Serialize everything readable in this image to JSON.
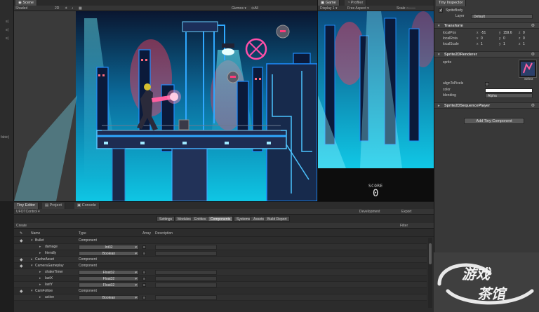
{
  "scene_panel": {
    "tab_label": "Scene",
    "toolbar": {
      "shading": "Shaded",
      "gizmos": "Gizmos ▾",
      "search": "⊙All"
    }
  },
  "game_panel": {
    "tabs": [
      "Game",
      "Profiler"
    ],
    "toolbar": {
      "display": "Display 1 ▾",
      "aspect": "Free Aspect ▾",
      "scale": "Scale ○——"
    },
    "score_label": "SCORE",
    "score_value": "0"
  },
  "left_strip": {
    "labels": [
      "≡|",
      "≡|",
      "≡|",
      "fabic)"
    ]
  },
  "inspector": {
    "tab_label": "Tiny Inspector",
    "entity_name": "SpriteBody",
    "layer_label": "Layer",
    "layer_value": "Default",
    "transform": {
      "title": "Transform",
      "rows": [
        {
          "label": "localPos",
          "x": "-51",
          "y": "159.6",
          "z": "0"
        },
        {
          "label": "localRota",
          "x": "0",
          "y": "0",
          "z": "0"
        },
        {
          "label": "localScale",
          "x": "1",
          "y": "1",
          "z": "1"
        }
      ]
    },
    "sprite_renderer": {
      "title": "Sprite2DRenderer",
      "sprite_label": "sprite",
      "select_label": "Select",
      "align_label": "alignToPixels",
      "color_label": "color",
      "blending_label": "blending",
      "blending_value": "Alpha"
    },
    "sequence_player": {
      "title": "Sprite2DSequencePlayer"
    },
    "add_component_label": "Add Tiny Component"
  },
  "bottom_panel": {
    "tabs": [
      "Tiny Editor",
      "Project",
      "Console"
    ],
    "project_name": "UFOTControl ▾",
    "mode": "Development",
    "export_label": "Export",
    "categories": [
      "Settings",
      "Modules",
      "Entities",
      "Components",
      "Systems",
      "Assets",
      "Build Report"
    ],
    "active_category": "Components",
    "create_label": "Create",
    "filter_placeholder": "Filter",
    "columns": [
      "Name",
      "Type",
      "Array",
      "Description"
    ],
    "rows": [
      {
        "name": "Bullet",
        "type": "Component",
        "kind": "component"
      },
      {
        "name": "damage",
        "type": "Int32",
        "kind": "field"
      },
      {
        "name": "friendly",
        "type": "Boolean",
        "kind": "field"
      },
      {
        "name": "CacheAsset",
        "type": "Component",
        "kind": "component"
      },
      {
        "name": "CameraGameplay",
        "type": "Component",
        "kind": "component"
      },
      {
        "name": "shakeTimer",
        "type": "Float32",
        "kind": "field"
      },
      {
        "name": "lastX",
        "type": "Float32",
        "kind": "field"
      },
      {
        "name": "lastY",
        "type": "Float32",
        "kind": "field"
      },
      {
        "name": "CamFollow",
        "type": "Component",
        "kind": "component"
      },
      {
        "name": "active",
        "type": "Boolean",
        "kind": "field"
      }
    ]
  },
  "colors": {
    "editor_bg": "#383838",
    "scene_sky": "#0fc6e4",
    "neon_blue": "#1e8dff",
    "neon_red": "#ff3b5c",
    "neon_pink": "#ff4fa8"
  }
}
